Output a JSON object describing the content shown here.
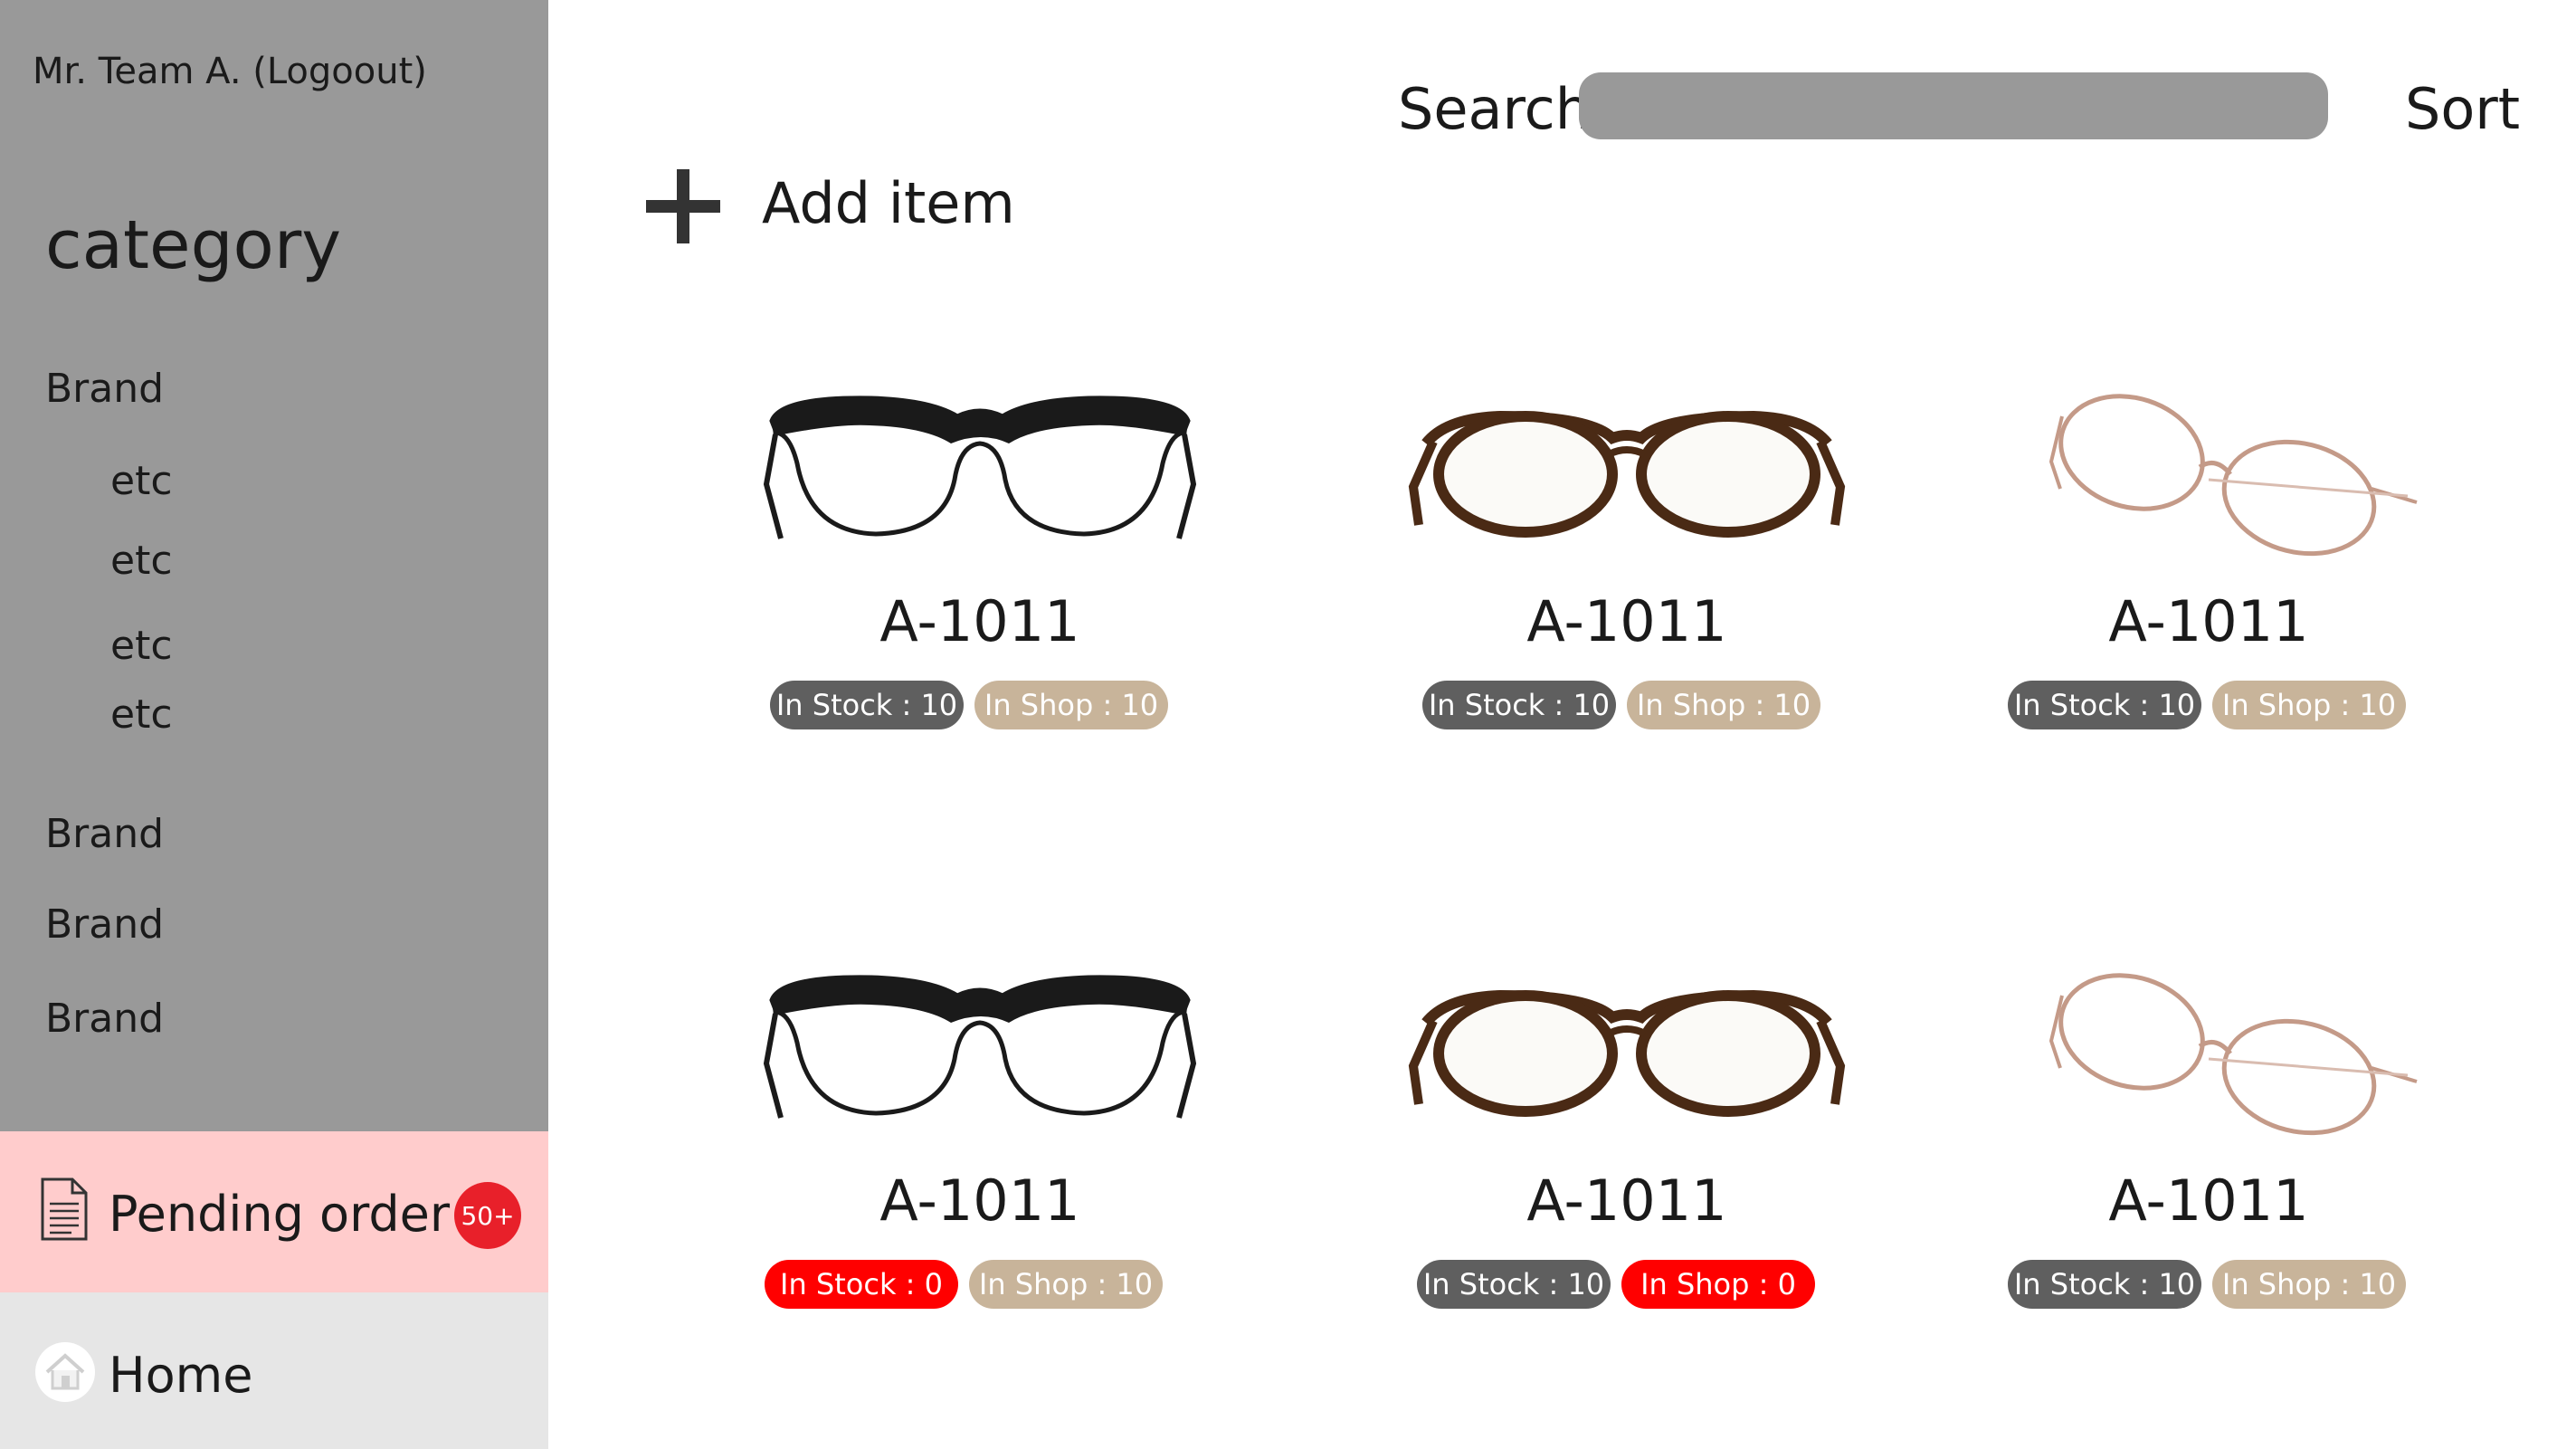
{
  "user": {
    "label": "Mr. Team A. (Logoout)"
  },
  "sidebar": {
    "title": "category",
    "items": [
      {
        "label": "Brand"
      },
      {
        "label": "etc"
      },
      {
        "label": "etc"
      },
      {
        "label": "etc"
      },
      {
        "label": "etc"
      },
      {
        "label": "Brand"
      },
      {
        "label": "Brand"
      },
      {
        "label": "Brand"
      }
    ],
    "pending": {
      "label": "Pending order",
      "badge": "50+",
      "icon": "document-icon"
    },
    "home": {
      "label": "Home",
      "icon": "home-icon"
    }
  },
  "search": {
    "label": "Search",
    "placeholder": ""
  },
  "sort": {
    "label": "Sort"
  },
  "add_item": {
    "label": "Add item",
    "icon": "plus-icon"
  },
  "colors": {
    "sidebar_bg": "#999999",
    "pending_bg": "#ffcccc",
    "home_bg": "#e6e6e6",
    "badge_red": "#e8202a",
    "pill_dark": "#5f5f5f",
    "pill_tan": "#c8b49a",
    "pill_alert": "#ff0000"
  },
  "products": [
    {
      "code": "A-1011",
      "style": "browline-black",
      "stock": "In Stock : 10",
      "shop": "In Shop : 10",
      "stock_status": "normal",
      "shop_status": "normal"
    },
    {
      "code": "A-1011",
      "style": "round-tortoise",
      "stock": "In Stock : 10",
      "shop": "In Shop : 10",
      "stock_status": "normal",
      "shop_status": "normal"
    },
    {
      "code": "A-1011",
      "style": "wire-gold",
      "stock": "In Stock : 10",
      "shop": "In Shop : 10",
      "stock_status": "normal",
      "shop_status": "normal"
    },
    {
      "code": "A-1011",
      "style": "browline-black",
      "stock": "In Stock : 0",
      "shop": "In Shop : 10",
      "stock_status": "alert",
      "shop_status": "normal"
    },
    {
      "code": "A-1011",
      "style": "round-tortoise",
      "stock": "In Stock : 10",
      "shop": "In Shop : 0",
      "stock_status": "normal",
      "shop_status": "alert"
    },
    {
      "code": "A-1011",
      "style": "wire-gold",
      "stock": "In Stock : 10",
      "shop": "In Shop : 10",
      "stock_status": "normal",
      "shop_status": "normal"
    }
  ]
}
